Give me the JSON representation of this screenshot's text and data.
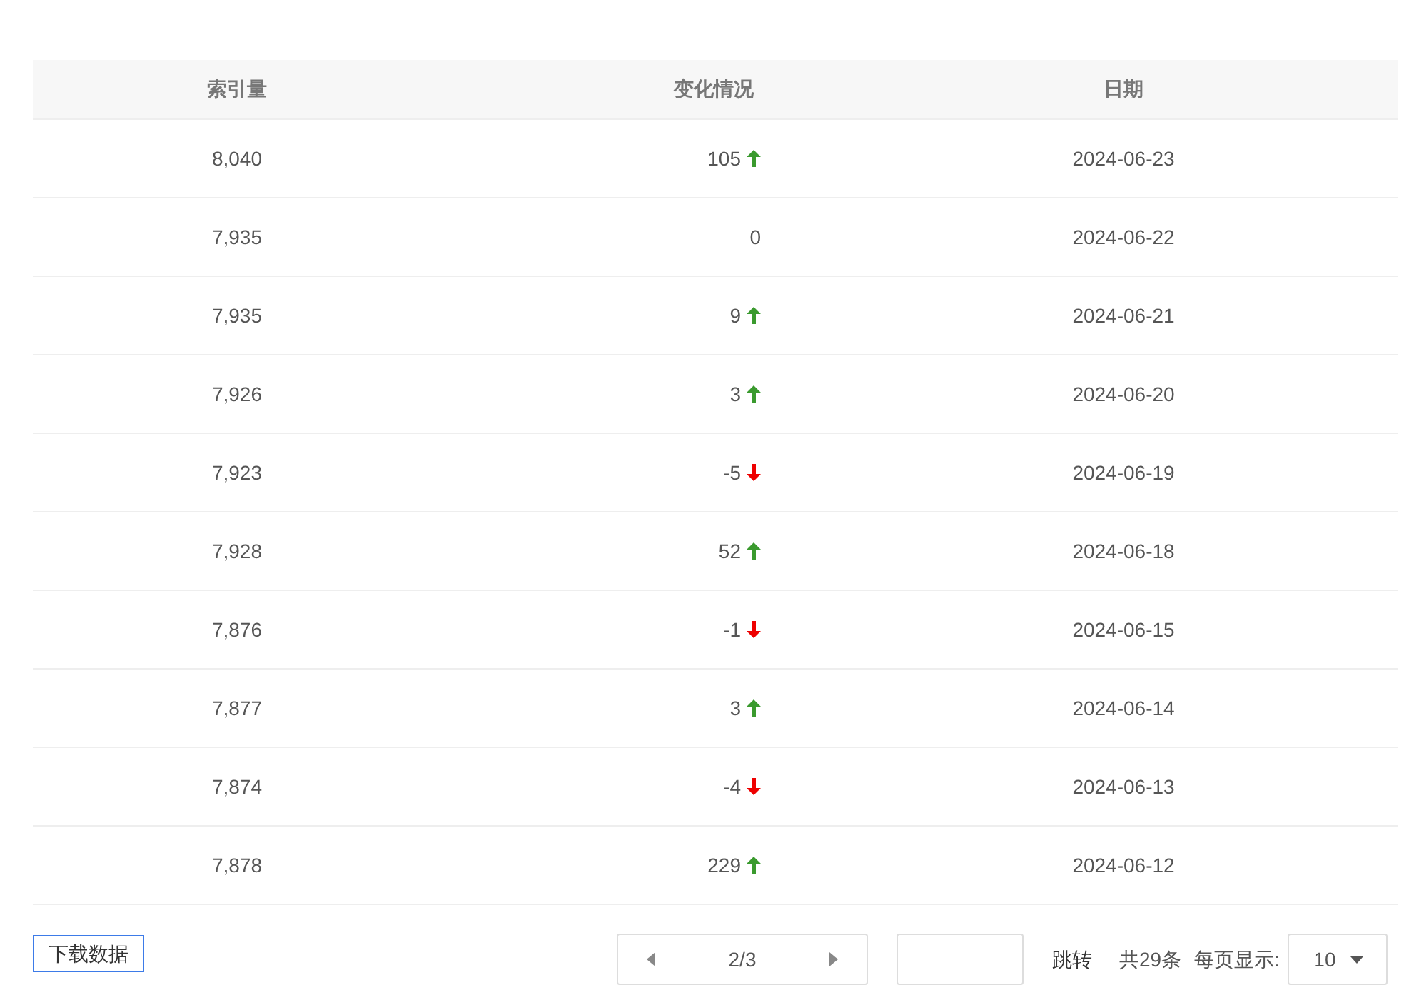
{
  "table": {
    "columns": [
      "索引量",
      "变化情况",
      "日期"
    ],
    "rows": [
      {
        "index": "8,040",
        "change": "105",
        "kind": "up",
        "date": "2024-06-23"
      },
      {
        "index": "7,935",
        "change": "0",
        "kind": "flat",
        "date": "2024-06-22"
      },
      {
        "index": "7,935",
        "change": "9",
        "kind": "up",
        "date": "2024-06-21"
      },
      {
        "index": "7,926",
        "change": "3",
        "kind": "up",
        "date": "2024-06-20"
      },
      {
        "index": "7,923",
        "change": "-5",
        "kind": "down",
        "date": "2024-06-19"
      },
      {
        "index": "7,928",
        "change": "52",
        "kind": "up",
        "date": "2024-06-18"
      },
      {
        "index": "7,876",
        "change": "-1",
        "kind": "down",
        "date": "2024-06-15"
      },
      {
        "index": "7,877",
        "change": "3",
        "kind": "up",
        "date": "2024-06-14"
      },
      {
        "index": "7,874",
        "change": "-4",
        "kind": "down",
        "date": "2024-06-13"
      },
      {
        "index": "7,878",
        "change": "229",
        "kind": "up",
        "date": "2024-06-12"
      }
    ]
  },
  "download_button": "下载数据",
  "pagination": {
    "page": "2/3",
    "jump_button": "跳转",
    "total": "共29条",
    "page_size_label": "每页显示:",
    "page_size": "10"
  }
}
